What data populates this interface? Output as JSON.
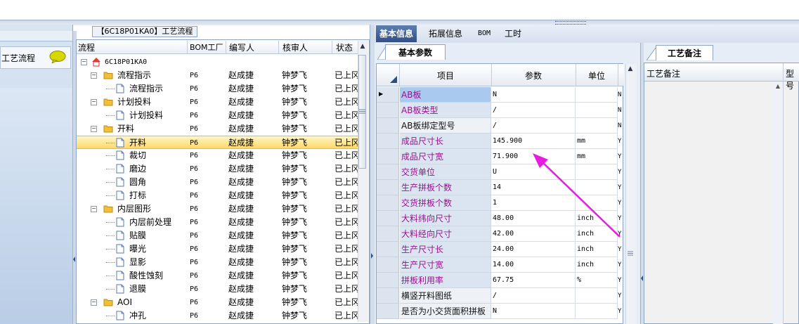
{
  "left_nav": {
    "item_label": "工艺流程"
  },
  "tree": {
    "title_tab": "【6C18P01KA0】工艺流程",
    "headers": {
      "flow": "流程",
      "bom_factory": "BOM工厂",
      "writer": "编写人",
      "checker": "核审人",
      "status": "状态"
    },
    "root": "6C18P01KA0",
    "rows": [
      {
        "label": "流程指示",
        "type": "folder",
        "level": 1,
        "bom": "P6",
        "writer": "赵成捷",
        "checker": "钟梦飞",
        "status": "已上冈"
      },
      {
        "label": "流程指示",
        "type": "doc",
        "level": 2,
        "bom": "P6",
        "writer": "赵成捷",
        "checker": "钟梦飞",
        "status": "已上冈"
      },
      {
        "label": "计划投料",
        "type": "folder",
        "level": 1,
        "bom": "P6",
        "writer": "赵成捷",
        "checker": "钟梦飞",
        "status": "已上冈"
      },
      {
        "label": "计划投料",
        "type": "doc",
        "level": 2,
        "bom": "P6",
        "writer": "赵成捷",
        "checker": "钟梦飞",
        "status": "已上冈"
      },
      {
        "label": "开料",
        "type": "folder",
        "level": 1,
        "bom": "P6",
        "writer": "赵成捷",
        "checker": "钟梦飞",
        "status": "已上冈"
      },
      {
        "label": "开料",
        "type": "doc",
        "level": 2,
        "bom": "P6",
        "writer": "赵成捷",
        "checker": "钟梦飞",
        "status": "已上冈",
        "selected": true
      },
      {
        "label": "裁切",
        "type": "doc",
        "level": 2,
        "bom": "P6",
        "writer": "赵成捷",
        "checker": "钟梦飞",
        "status": "已上冈"
      },
      {
        "label": "磨边",
        "type": "doc",
        "level": 2,
        "bom": "P6",
        "writer": "赵成捷",
        "checker": "钟梦飞",
        "status": "已上冈"
      },
      {
        "label": "圆角",
        "type": "doc",
        "level": 2,
        "bom": "P6",
        "writer": "赵成捷",
        "checker": "钟梦飞",
        "status": "已上冈"
      },
      {
        "label": "打标",
        "type": "doc",
        "level": 2,
        "bom": "P6",
        "writer": "赵成捷",
        "checker": "钟梦飞",
        "status": "已上冈"
      },
      {
        "label": "内层图形",
        "type": "folder",
        "level": 1,
        "bom": "P6",
        "writer": "赵成捷",
        "checker": "钟梦飞",
        "status": "已上冈"
      },
      {
        "label": "内层前处理",
        "type": "doc",
        "level": 2,
        "bom": "P6",
        "writer": "赵成捷",
        "checker": "钟梦飞",
        "status": "已上冈"
      },
      {
        "label": "贴膜",
        "type": "doc",
        "level": 2,
        "bom": "P6",
        "writer": "赵成捷",
        "checker": "钟梦飞",
        "status": "已上冈"
      },
      {
        "label": "曝光",
        "type": "doc",
        "level": 2,
        "bom": "P6",
        "writer": "赵成捷",
        "checker": "钟梦飞",
        "status": "已上冈"
      },
      {
        "label": "显影",
        "type": "doc",
        "level": 2,
        "bom": "P6",
        "writer": "赵成捷",
        "checker": "钟梦飞",
        "status": "已上冈"
      },
      {
        "label": "酸性蚀刻",
        "type": "doc",
        "level": 2,
        "bom": "P6",
        "writer": "赵成捷",
        "checker": "钟梦飞",
        "status": "已上冈"
      },
      {
        "label": "退膜",
        "type": "doc",
        "level": 2,
        "bom": "P6",
        "writer": "赵成捷",
        "checker": "钟梦飞",
        "status": "已上冈"
      },
      {
        "label": "AOI",
        "type": "folder",
        "level": 1,
        "bom": "P6",
        "writer": "赵成捷",
        "checker": "钟梦飞",
        "status": "已上冈"
      },
      {
        "label": "冲孔",
        "type": "doc",
        "level": 2,
        "bom": "P6",
        "writer": "赵成捷",
        "checker": "钟梦飞",
        "status": "已上冈"
      }
    ]
  },
  "tabs": {
    "basic_info": "基本信息",
    "extended_info": "拓展信息",
    "bom": "BOM",
    "hours": "工时"
  },
  "params": {
    "subtab": "基本参数",
    "headers": {
      "item": "项目",
      "value": "参数",
      "unit": "单位"
    },
    "rows": [
      {
        "name": "AB板",
        "value": "N",
        "unit": "",
        "flag": "N",
        "color": "purple",
        "current": true
      },
      {
        "name": "AB板类型",
        "value": "/",
        "unit": "",
        "flag": "N",
        "color": "purple"
      },
      {
        "name": "AB板绑定型号",
        "value": "/",
        "unit": "",
        "flag": "N",
        "color": "black"
      },
      {
        "name": "成品尺寸长",
        "value": "145.900",
        "unit": "mm",
        "flag": "Y",
        "color": "purple"
      },
      {
        "name": "成品尺寸宽",
        "value": "71.900",
        "unit": "mm",
        "flag": "Y",
        "color": "purple"
      },
      {
        "name": "交货单位",
        "value": "U",
        "unit": "",
        "flag": "Y",
        "color": "purple"
      },
      {
        "name": "生产拼板个数",
        "value": "14",
        "unit": "",
        "flag": "Y",
        "color": "purple"
      },
      {
        "name": "交货拼板个数",
        "value": "1",
        "unit": "",
        "flag": "Y",
        "color": "purple"
      },
      {
        "name": "大料纬向尺寸",
        "value": "48.00",
        "unit": "inch",
        "flag": "Y",
        "color": "purple"
      },
      {
        "name": "大料经向尺寸",
        "value": "42.00",
        "unit": "inch",
        "flag": "Y",
        "color": "purple"
      },
      {
        "name": "生产尺寸长",
        "value": "24.00",
        "unit": "inch",
        "flag": "Y",
        "color": "purple"
      },
      {
        "name": "生产尺寸宽",
        "value": "14.00",
        "unit": "inch",
        "flag": "Y",
        "color": "purple"
      },
      {
        "name": "拼板利用率",
        "value": "67.75",
        "unit": "%",
        "flag": "Y",
        "color": "purple"
      },
      {
        "name": "横竖开料图纸",
        "value": "/",
        "unit": "",
        "flag": "Y",
        "color": "black"
      },
      {
        "name": "是否为小交货面积拼板",
        "value": "N",
        "unit": "",
        "flag": "Y",
        "color": "black"
      }
    ]
  },
  "remarks": {
    "tab": "工艺备注",
    "col1": "工艺备注",
    "col2": "型号"
  },
  "colors": {
    "purple_text": "#9b108f",
    "arrow": "#e81ce0",
    "active_tab": "#3a5a8f",
    "selected_row": "#ffd86a"
  }
}
